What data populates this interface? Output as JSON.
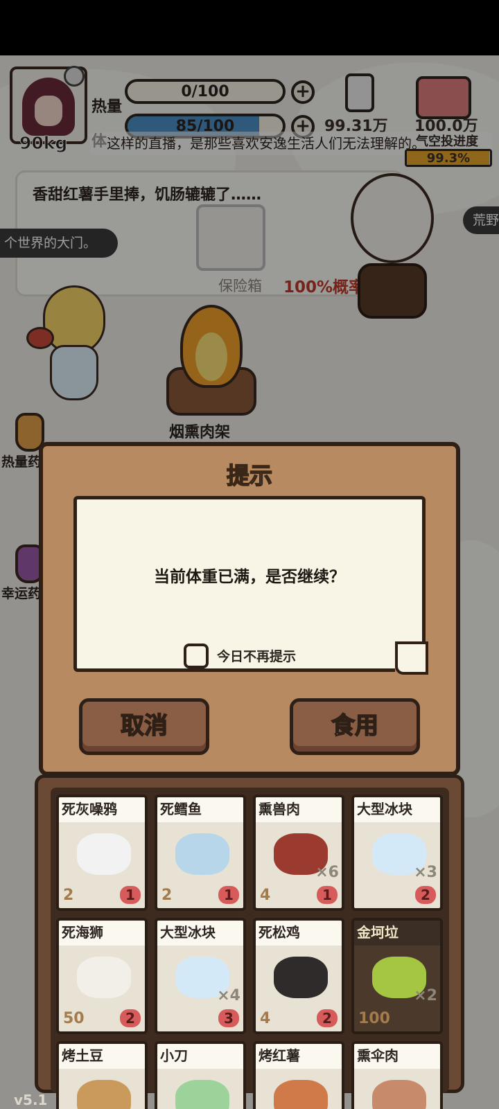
{
  "hud": {
    "weight": "90kg",
    "heat_label": "热量",
    "body_label": "体",
    "heat_value": "0/100",
    "weight_bar_value": "85/100",
    "weight_bar_fraction": 0.85,
    "coins_a": "99.31万",
    "coins_b": "100.0万",
    "marquee": "这样的直播，是那些喜欢安逸生活人们无法理解的。",
    "progress_label": "气空投进度",
    "progress_value": "99.3%",
    "progress_fraction": 0.993
  },
  "scene": {
    "bubble_text": "香甜红薯手里捧，饥肠辘辘了……",
    "item_label": "保险箱",
    "success_rate": "100%概率成功",
    "left_pill": "个世界的大门。",
    "right_pill": "荒野",
    "fire_label": "烟熏肉架",
    "side_label_1": "热量药",
    "side_label_2": "幸运药",
    "version": "v5.1"
  },
  "dialog": {
    "title": "提示",
    "message": "当前体重已满，是否继续？",
    "checkbox_label": "今日不再提示",
    "cancel_label": "取消",
    "confirm_label": "食用"
  },
  "inventory": [
    {
      "name": "死灰噪鸦",
      "qty": "",
      "left": "2",
      "right": "1",
      "color": "#f2f2f2"
    },
    {
      "name": "死鳕鱼",
      "qty": "",
      "left": "2",
      "right": "1",
      "color": "#b8d6ea"
    },
    {
      "name": "熏兽肉",
      "qty": "×6",
      "left": "4",
      "right": "1",
      "color": "#9b3a2e"
    },
    {
      "name": "大型冰块",
      "qty": "×3",
      "left": "",
      "right": "2",
      "color": "#d4e9f7"
    },
    {
      "name": "死海狮",
      "qty": "",
      "left": "50",
      "right": "2",
      "color": "#f1efe8"
    },
    {
      "name": "大型冰块",
      "qty": "×4",
      "left": "",
      "right": "3",
      "color": "#d4e9f7"
    },
    {
      "name": "死松鸡",
      "qty": "",
      "left": "4",
      "right": "2",
      "color": "#2f2b2b"
    },
    {
      "name": "金坷垃",
      "qty": "×2",
      "left": "100",
      "right": "",
      "color": "#a5c642"
    },
    {
      "name": "烤土豆",
      "qty": "",
      "left": "",
      "right": "",
      "color": "#c99a5c"
    },
    {
      "name": "小刀",
      "qty": "",
      "left": "",
      "right": "",
      "color": "#9bd39b"
    },
    {
      "name": "烤红薯",
      "qty": "",
      "left": "",
      "right": "",
      "color": "#d07a4a"
    },
    {
      "name": "熏伞肉",
      "qty": "",
      "left": "",
      "right": "",
      "color": "#c78a6a"
    }
  ]
}
